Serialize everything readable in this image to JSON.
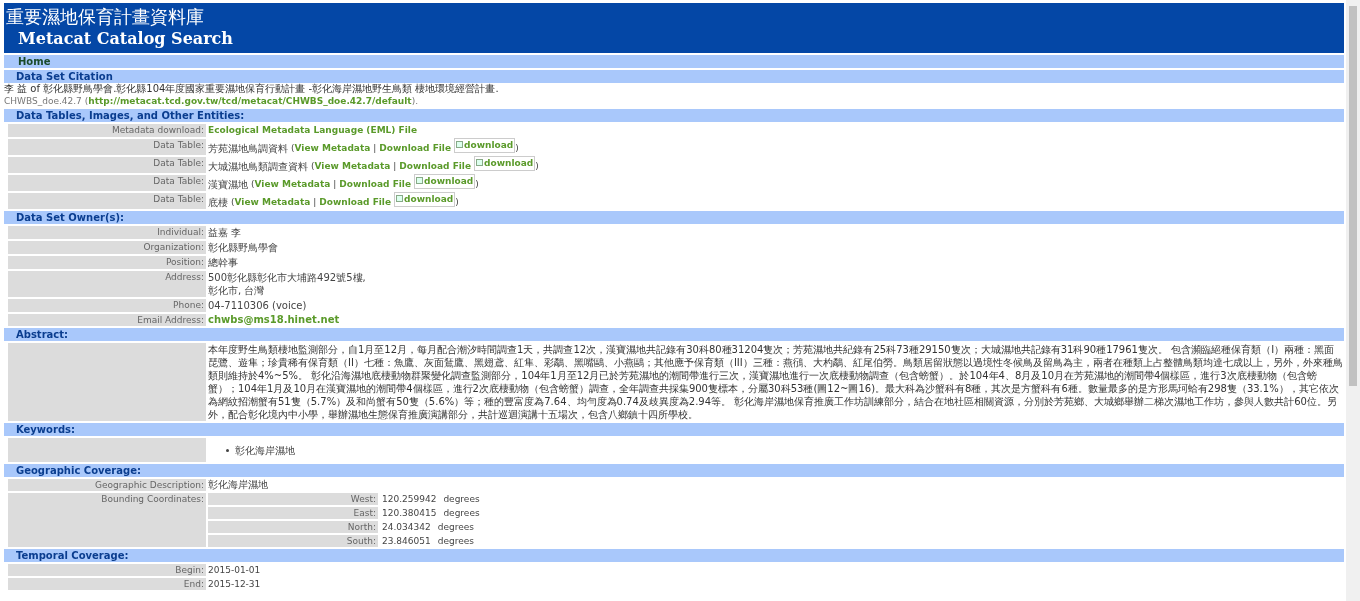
{
  "header": {
    "title": "重要濕地保育計畫資料庫",
    "subtitle": "Metacat Catalog Search"
  },
  "nav": [
    {
      "label": "Home"
    }
  ],
  "citation": {
    "heading": "Data Set Citation",
    "text": "李 益 of 彰化縣野鳥學會.彰化縣104年度國家重要濕地保育行動計畫 -彰化海岸濕地野生鳥類 棲地環境經營計畫.",
    "id": "CHWBS_doe.42.7",
    "open": "(",
    "url": "http://metacat.tcd.gov.tw/tcd/metacat/CHWBS_doe.42.7/default",
    "close": ")."
  },
  "entities": {
    "heading": "Data Tables, Images, and Other Entities:",
    "metadata": {
      "label": "Metadata download:",
      "link": "Ecological Metadata Language (EML) File"
    },
    "tables": [
      {
        "label": "Data Table:",
        "name": "芳苑濕地鳥調資料",
        "open": "(",
        "view": "View Metadata",
        "sep": "|",
        "download": "Download File",
        "image_alt": "download",
        "close": ")"
      },
      {
        "label": "Data Table:",
        "name": "大城濕地鳥類調查資料",
        "open": "(",
        "view": "View Metadata",
        "sep": "|",
        "download": "Download File",
        "image_alt": "download",
        "close": ")"
      },
      {
        "label": "Data Table:",
        "name": "漢寶濕地",
        "open": "(",
        "view": "View Metadata",
        "sep": "|",
        "download": "Download File",
        "image_alt": "download",
        "close": ")"
      },
      {
        "label": "Data Table:",
        "name": "底棲",
        "open": "(",
        "view": "View Metadata",
        "sep": "|",
        "download": "Download File",
        "image_alt": "download",
        "close": ")"
      }
    ]
  },
  "owner": {
    "heading": "Data Set Owner(s):",
    "rows": [
      {
        "label": "Individual:",
        "lines": [
          "益嘉 李"
        ],
        "kind": "plain"
      },
      {
        "label": "Organization:",
        "lines": [
          "彰化縣野鳥學會"
        ],
        "kind": "plain"
      },
      {
        "label": "Position:",
        "lines": [
          "總幹事"
        ],
        "kind": "plain"
      },
      {
        "label": "Address:",
        "lines": [
          "500彰化縣彰化市大埔路492號5樓,",
          "彰化市, 台灣"
        ],
        "kind": "plain"
      },
      {
        "label": "Phone:",
        "lines": [
          "04-7110306 (voice)"
        ],
        "kind": "plain"
      },
      {
        "label": "Email Address:",
        "lines": [
          "chwbs@ms18.hinet.net"
        ],
        "kind": "link"
      }
    ]
  },
  "abstract": {
    "heading": "Abstract:",
    "text": "本年度野生鳥類棲地監測部分，自1月至12月，每月配合潮汐時間調查1天，共調查12次，漢寶濕地共記錄有30科80種31204隻次；芳苑濕地共紀錄有25科73種29150隻次；大城濕地共記錄有31科90種17961隻次。 包含瀕臨絕種保育類（I）兩種：黑面琵鷺、遊隼；珍貴稀有保育類（II）七種：魚鷹、灰面鵟鷹、黑翅鳶、紅隼、彩鷸、黑嘴鷗、小燕鷗；其他應予保育類（III）三種：燕鴴、大杓鷸、紅尾伯勞。鳥類居留狀態以過境性冬候鳥及留鳥為主，兩者在種類上占整體鳥類均達七成以上，另外，外來種鳥類則維持於4%~5%。 彰化沿海濕地底棲動物群聚變化調查監測部分，104年1月至12月已於芳苑濕地的潮間帶進行三次，漢寶濕地進行一次底棲動物調查（包含螃蟹）。於104年4、8月及10月在芳苑濕地的潮間帶4個樣區，進行3次底棲動物（包含螃蟹）；104年1月及10月在漢寶濕地的潮間帶4個樣區，進行2次底棲動物（包含螃蟹）調查，全年調查共採集900隻標本，分屬30科53種(圖12~圖16)。最大科為沙蟹科有8種，其次是方蟹科有6種。數量最多的是方形馬珂蛤有298隻（33.1%），其它依次為網紋招潮蟹有51隻（5.7%）及和尚蟹有50隻（5.6%）等；種的豐富度為7.64、均勻度為0.74及歧異度為2.94等。 彰化海岸濕地保育推廣工作坊訓練部分，結合在地社區相關資源，分別於芳苑鄉、大城鄉舉辦二梯次濕地工作坊，參與人數共計60位。另外，配合彰化境內中小學，舉辦濕地生態保育推廣演講部分，共計巡迴演講十五場次，包含八鄉鎮十四所學校。"
  },
  "keywords": {
    "heading": "Keywords:",
    "items": [
      "彰化海岸濕地"
    ]
  },
  "geographic": {
    "heading": "Geographic Coverage:",
    "description_label": "Geographic Description:",
    "description": "彰化海岸濕地",
    "bounding_label": "Bounding Coordinates:",
    "bounds": [
      {
        "label": "West:",
        "value": "120.259942",
        "unit": "degrees"
      },
      {
        "label": "East:",
        "value": "120.380415",
        "unit": "degrees"
      },
      {
        "label": "North:",
        "value": "24.034342",
        "unit": "degrees"
      },
      {
        "label": "South:",
        "value": "23.846051",
        "unit": "degrees"
      }
    ]
  },
  "temporal": {
    "heading": "Temporal Coverage:",
    "rows": [
      {
        "label": "Begin:",
        "value": "2015-01-01"
      },
      {
        "label": "End:",
        "value": "2015-12-31"
      }
    ]
  }
}
